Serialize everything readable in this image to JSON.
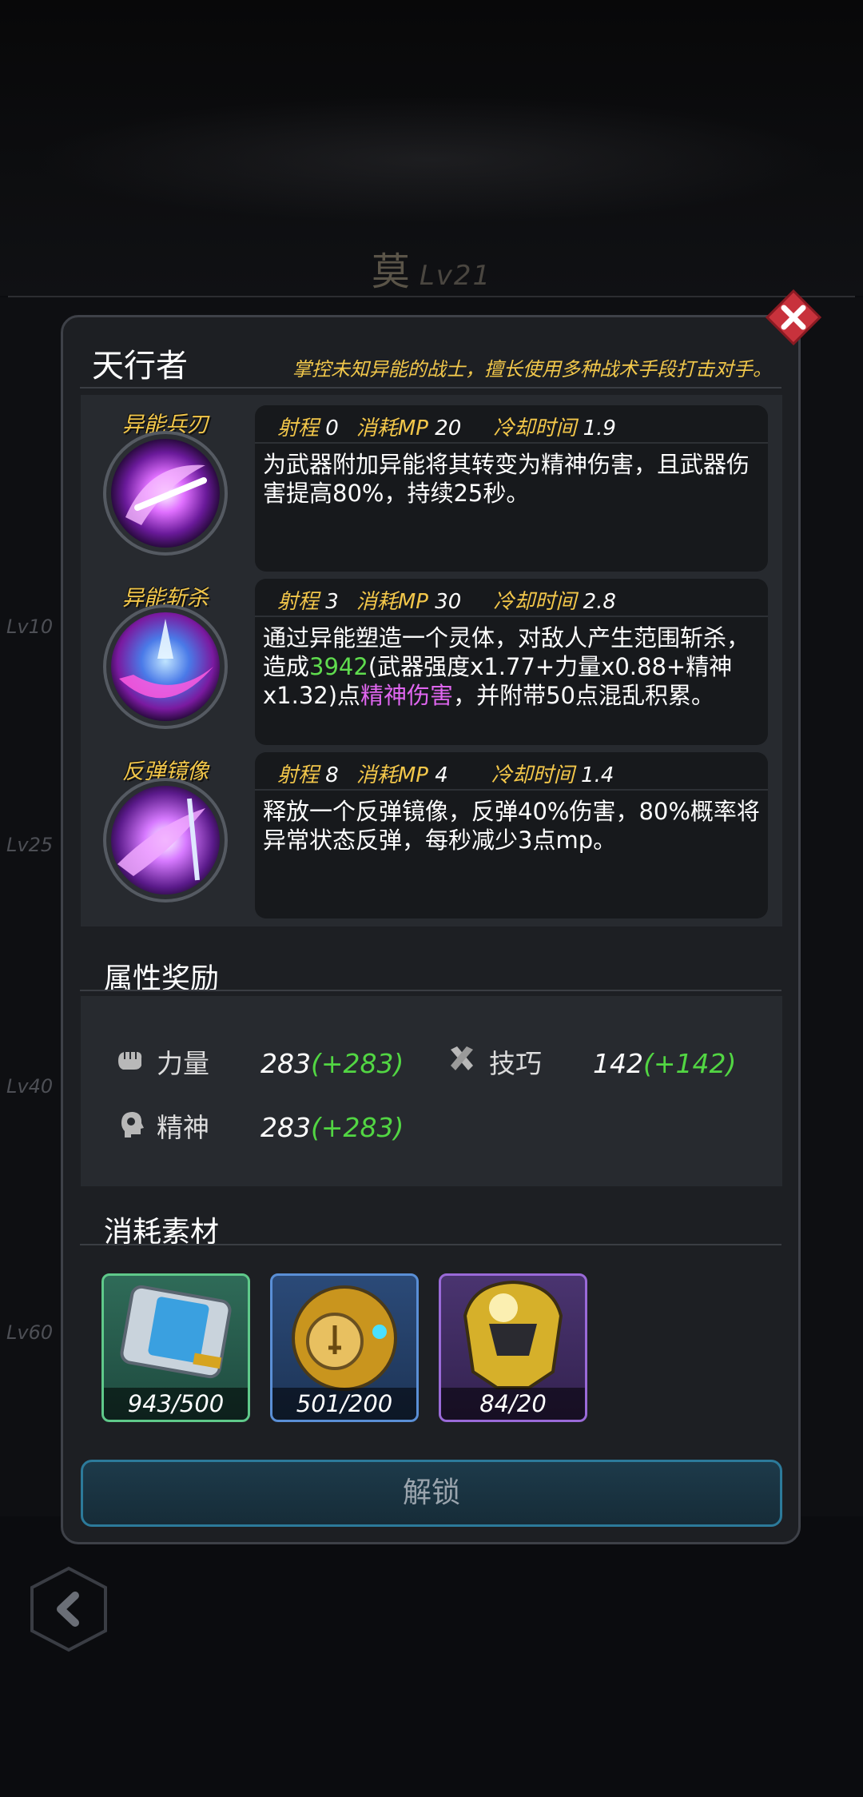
{
  "hero": {
    "name": "莫",
    "level": "Lv21"
  },
  "side_levels": [
    "Lv10",
    "Lv25",
    "Lv40",
    "Lv60"
  ],
  "panel": {
    "class_title": "天行者",
    "class_desc": "掌控未知异能的战士，擅长使用多种战术手段打击对手。",
    "skills": [
      {
        "name": "异能兵刃",
        "range_label": "射程",
        "range": "0",
        "mp_label": "消耗MP",
        "mp": "20",
        "cd_label": "冷却时间",
        "cd": "1.9",
        "desc": "为武器附加异能将其转变为精神伤害，且武器伤害提高80%，持续25秒。",
        "icon": "purple-blade-icon"
      },
      {
        "name": "异能斩杀",
        "range_label": "射程",
        "range": "3",
        "mp_label": "消耗MP",
        "mp": "30",
        "cd_label": "冷却时间",
        "cd": "2.8",
        "desc_pre": "通过异能塑造一个灵体，对敌人产生范围斩杀，造成",
        "desc_num": "3942",
        "desc_mid": "(武器强度x1.77+力量x0.88+精神x1.32)点",
        "desc_pink": "精神伤害",
        "desc_post": "，并附带50点混乱积累。",
        "icon": "spirit-slash-icon"
      },
      {
        "name": "反弹镜像",
        "range_label": "射程",
        "range": "8",
        "mp_label": "消耗MP",
        "mp": "4",
        "cd_label": "冷却时间",
        "cd": "1.4",
        "desc": "释放一个反弹镜像，反弹40%伤害，80%概率将异常状态反弹，每秒减少3点mp。",
        "icon": "mirror-reflect-icon"
      }
    ],
    "attr_title": "属性奖励",
    "attributes": [
      {
        "label": "力量",
        "value": "283",
        "bonus": "(+283)",
        "icon": "fist-icon"
      },
      {
        "label": "技巧",
        "value": "142",
        "bonus": "(+142)",
        "icon": "crossed-tools-icon"
      },
      {
        "label": "精神",
        "value": "283",
        "bonus": "(+283)",
        "icon": "head-icon"
      }
    ],
    "materials_title": "消耗素材",
    "materials": [
      {
        "count": "943/500",
        "icon": "data-card-icon",
        "border": "#5fc98a"
      },
      {
        "count": "501/200",
        "icon": "gold-sphere-icon",
        "border": "#5a8fd6"
      },
      {
        "count": "84/20",
        "icon": "gold-helmet-icon",
        "border": "#9a6ad8"
      }
    ],
    "unlock_label": "解锁"
  },
  "colors": {
    "accent_gold": "#f3c74a",
    "bonus_green": "#52d643",
    "damage_pink": "#e066f0",
    "close_red": "#c8323c"
  }
}
